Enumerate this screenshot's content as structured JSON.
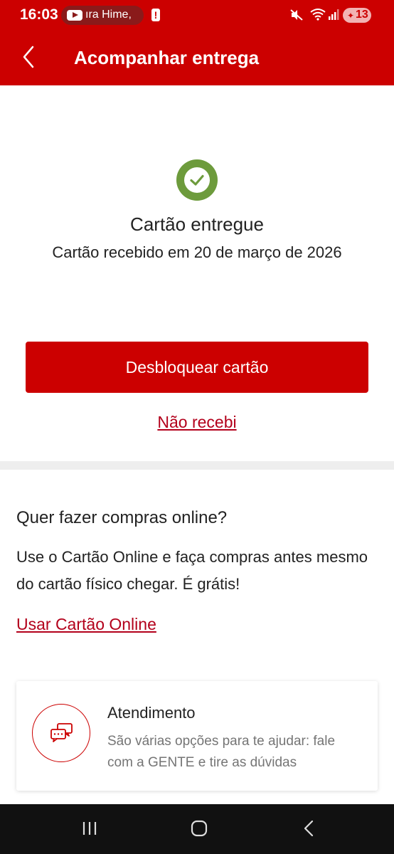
{
  "status_bar": {
    "time": "16:03",
    "media_text": "ıra Hime,",
    "alert_glyph": "!",
    "battery_level": "13"
  },
  "header": {
    "title": "Acompanhar entrega"
  },
  "delivery": {
    "status": "Cartão entregue",
    "date_text": "Cartão recebido em 20 de março de 2026",
    "unlock_button": "Desbloquear cartão",
    "not_received_link": "Não recebi"
  },
  "online": {
    "title": "Quer fazer compras online?",
    "description": "Use o Cartão Online e faça compras antes mesmo do cartão físico chegar. É grátis!",
    "link": "Usar Cartão Online"
  },
  "support": {
    "title": "Atendimento",
    "description": "São várias opções para te ajudar: fale com a GENTE e tire as dúvidas"
  },
  "colors": {
    "brand_red": "#cc0000",
    "link_red": "#b3001b",
    "success_green": "#6d9b3c"
  }
}
